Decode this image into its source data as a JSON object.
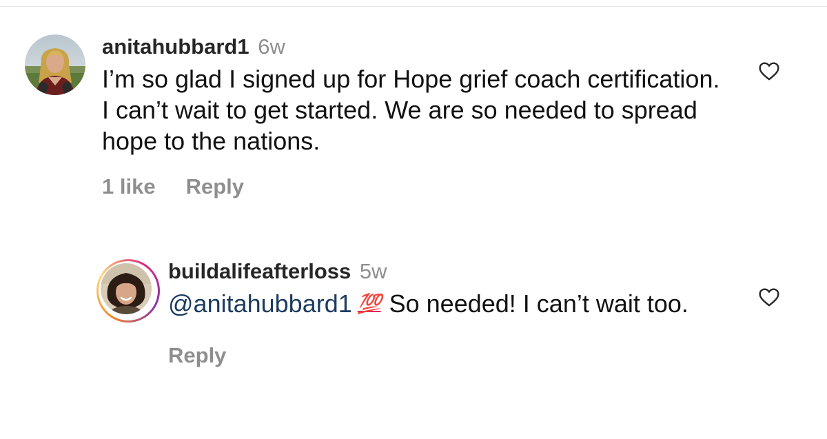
{
  "comments": [
    {
      "username": "anitahubbard1",
      "time": "6w",
      "text": "I’m so glad I signed up for Hope grief coach certification. I can’t wait to get started. We are so needed to spread hope to the nations.",
      "likes": "1 like",
      "reply_label": "Reply",
      "avatar_icon": "user-avatar-photo",
      "like_icon": "heart-outline-icon"
    },
    {
      "username": "buildalifeafterloss",
      "time": "5w",
      "mention": "@anitahubbard1",
      "emoji": "💯",
      "text": "So needed! I can’t wait too.",
      "reply_label": "Reply",
      "avatar_icon": "user-avatar-photo-with-story-ring",
      "like_icon": "heart-outline-icon"
    }
  ],
  "colors": {
    "text": "#111111",
    "secondary": "#8e8e8e",
    "mention": "#1d3b5f",
    "emoji": "#e0245e"
  }
}
